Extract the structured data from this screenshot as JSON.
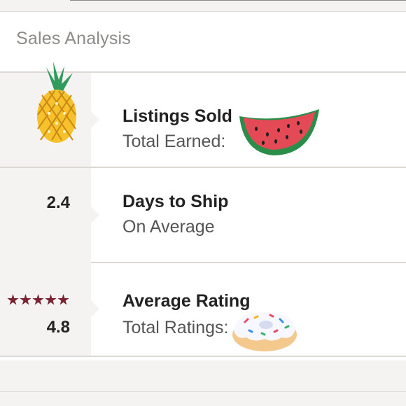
{
  "card": {
    "title": "Sales Analysis"
  },
  "rows": [
    {
      "title": "Listings Sold",
      "subtitle": "Total Earned:",
      "sticker": "pineapple-sticker",
      "sticker2": "watermelon-sticker"
    },
    {
      "value": "2.4",
      "title": "Days to Ship",
      "subtitle": "On Average"
    },
    {
      "value": "4.8",
      "title": "Average Rating",
      "subtitle": "Total Ratings:",
      "stars": 5,
      "sticker": "donut-sticker"
    }
  ],
  "colors": {
    "star": "#7a2230",
    "divider": "#dcd9d5",
    "left_panel": "#f4f3f1"
  }
}
